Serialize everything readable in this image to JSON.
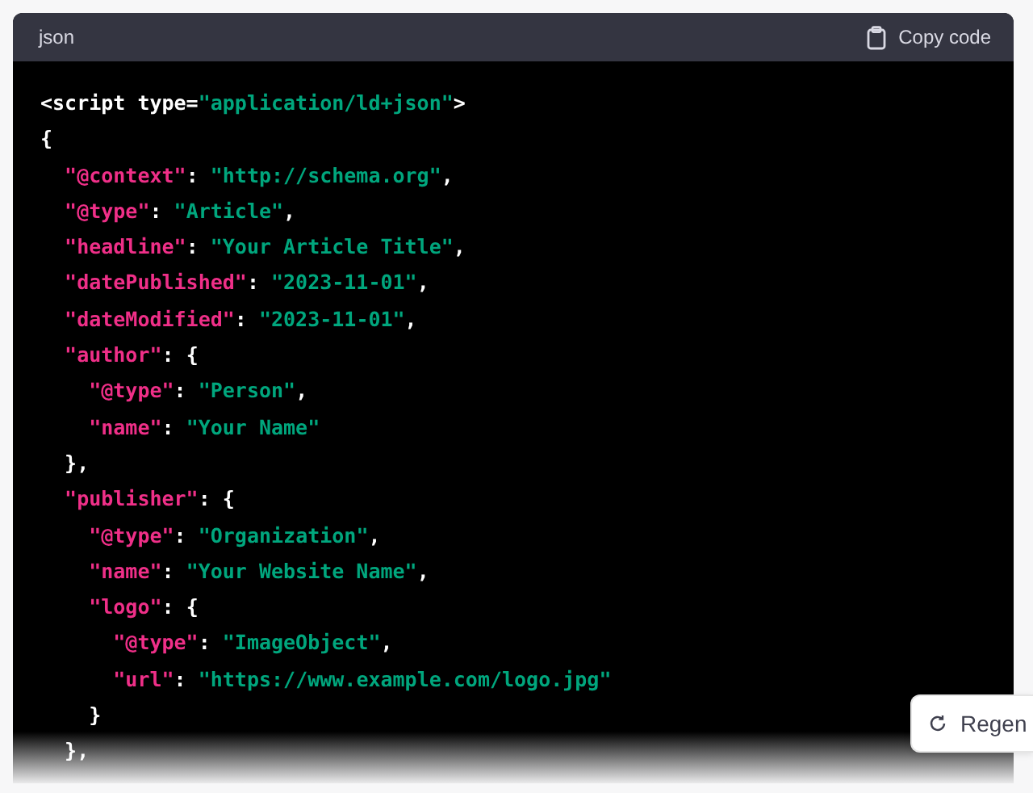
{
  "code_block": {
    "language": "json",
    "copy_label": "Copy code",
    "lines": [
      [
        {
          "kind": "plain",
          "text": "<script type="
        },
        {
          "kind": "string",
          "text": "\"application/ld+json\""
        },
        {
          "kind": "plain",
          "text": ">"
        }
      ],
      [
        {
          "kind": "plain",
          "text": "{"
        }
      ],
      [
        {
          "kind": "key",
          "text": "  \"@context\""
        },
        {
          "kind": "plain",
          "text": ": "
        },
        {
          "kind": "string",
          "text": "\"http://schema.org\""
        },
        {
          "kind": "plain",
          "text": ","
        }
      ],
      [
        {
          "kind": "key",
          "text": "  \"@type\""
        },
        {
          "kind": "plain",
          "text": ": "
        },
        {
          "kind": "string",
          "text": "\"Article\""
        },
        {
          "kind": "plain",
          "text": ","
        }
      ],
      [
        {
          "kind": "key",
          "text": "  \"headline\""
        },
        {
          "kind": "plain",
          "text": ": "
        },
        {
          "kind": "string",
          "text": "\"Your Article Title\""
        },
        {
          "kind": "plain",
          "text": ","
        }
      ],
      [
        {
          "kind": "key",
          "text": "  \"datePublished\""
        },
        {
          "kind": "plain",
          "text": ": "
        },
        {
          "kind": "string",
          "text": "\"2023-11-01\""
        },
        {
          "kind": "plain",
          "text": ","
        }
      ],
      [
        {
          "kind": "key",
          "text": "  \"dateModified\""
        },
        {
          "kind": "plain",
          "text": ": "
        },
        {
          "kind": "string",
          "text": "\"2023-11-01\""
        },
        {
          "kind": "plain",
          "text": ","
        }
      ],
      [
        {
          "kind": "key",
          "text": "  \"author\""
        },
        {
          "kind": "plain",
          "text": ": {"
        }
      ],
      [
        {
          "kind": "key",
          "text": "    \"@type\""
        },
        {
          "kind": "plain",
          "text": ": "
        },
        {
          "kind": "string",
          "text": "\"Person\""
        },
        {
          "kind": "plain",
          "text": ","
        }
      ],
      [
        {
          "kind": "key",
          "text": "    \"name\""
        },
        {
          "kind": "plain",
          "text": ": "
        },
        {
          "kind": "string",
          "text": "\"Your Name\""
        }
      ],
      [
        {
          "kind": "plain",
          "text": "  },"
        }
      ],
      [
        {
          "kind": "key",
          "text": "  \"publisher\""
        },
        {
          "kind": "plain",
          "text": ": {"
        }
      ],
      [
        {
          "kind": "key",
          "text": "    \"@type\""
        },
        {
          "kind": "plain",
          "text": ": "
        },
        {
          "kind": "string",
          "text": "\"Organization\""
        },
        {
          "kind": "plain",
          "text": ","
        }
      ],
      [
        {
          "kind": "key",
          "text": "    \"name\""
        },
        {
          "kind": "plain",
          "text": ": "
        },
        {
          "kind": "string",
          "text": "\"Your Website Name\""
        },
        {
          "kind": "plain",
          "text": ","
        }
      ],
      [
        {
          "kind": "key",
          "text": "    \"logo\""
        },
        {
          "kind": "plain",
          "text": ": {"
        }
      ],
      [
        {
          "kind": "key",
          "text": "      \"@type\""
        },
        {
          "kind": "plain",
          "text": ": "
        },
        {
          "kind": "string",
          "text": "\"ImageObject\""
        },
        {
          "kind": "plain",
          "text": ","
        }
      ],
      [
        {
          "kind": "key",
          "text": "      \"url\""
        },
        {
          "kind": "plain",
          "text": ": "
        },
        {
          "kind": "string",
          "text": "\"https://www.example.com/logo.jpg\""
        }
      ],
      [
        {
          "kind": "plain",
          "text": "    }"
        }
      ],
      [
        {
          "kind": "plain",
          "text": "  },"
        }
      ]
    ]
  },
  "regenerate_button": {
    "label": "Regen"
  }
}
